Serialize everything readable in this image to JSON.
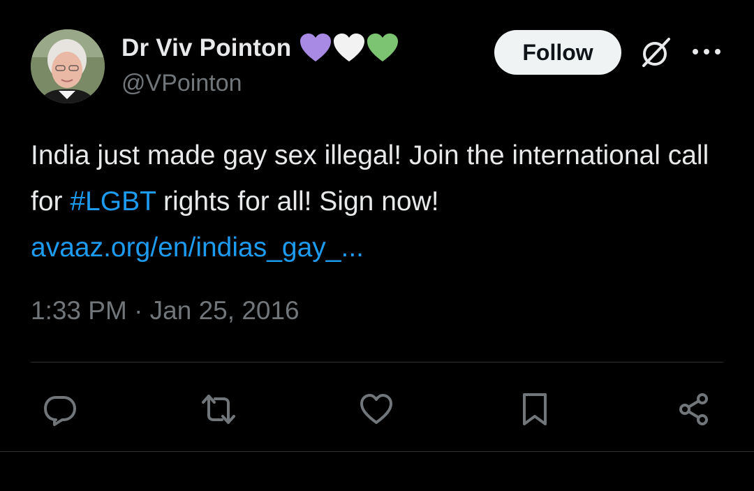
{
  "author": {
    "display_name": "Dr Viv Pointon",
    "handle": "@VPointon",
    "heart_colors": [
      "#a889e3",
      "#f2f2f2",
      "#7cc471"
    ]
  },
  "header": {
    "follow_label": "Follow"
  },
  "tweet": {
    "text_part1": "India just made gay sex illegal! Join the international call for ",
    "hashtag": "#LGBT",
    "text_part2": " rights for all! Sign now! ",
    "link_text": "avaaz.org/en/indias_gay_...",
    "timestamp": "1:33 PM · Jan 25, 2016"
  },
  "actions": [
    "reply-icon",
    "retweet-icon",
    "like-icon",
    "bookmark-icon",
    "share-icon"
  ],
  "colors": {
    "background": "#000000",
    "text": "#e7e9ea",
    "secondary": "#71767b",
    "link": "#1d9bf0",
    "divider": "#2f3336"
  }
}
